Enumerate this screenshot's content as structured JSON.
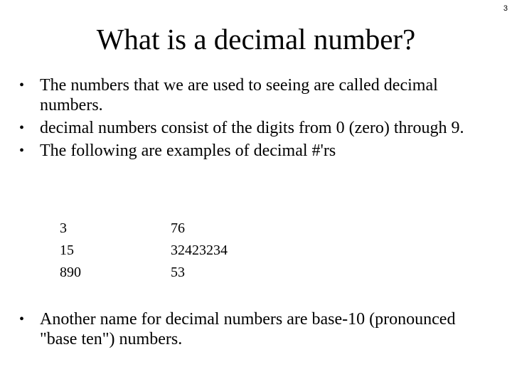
{
  "page_number": "3",
  "title": "What is a decimal number?",
  "bullets": [
    {
      "text": "The numbers that we are used to seeing are called decimal numbers."
    },
    {
      "text": "decimal numbers consist of the digits from 0 (zero) through 9."
    },
    {
      "text": "The following are examples of decimal #'rs"
    }
  ],
  "examples": {
    "column1": [
      "3",
      "15",
      "890"
    ],
    "column2": [
      "76",
      "32423234",
      "53"
    ]
  },
  "final_bullet": {
    "text": "Another name for decimal numbers are base-10 (pronounced \"base ten\") numbers."
  },
  "bullet_glyph": "•"
}
